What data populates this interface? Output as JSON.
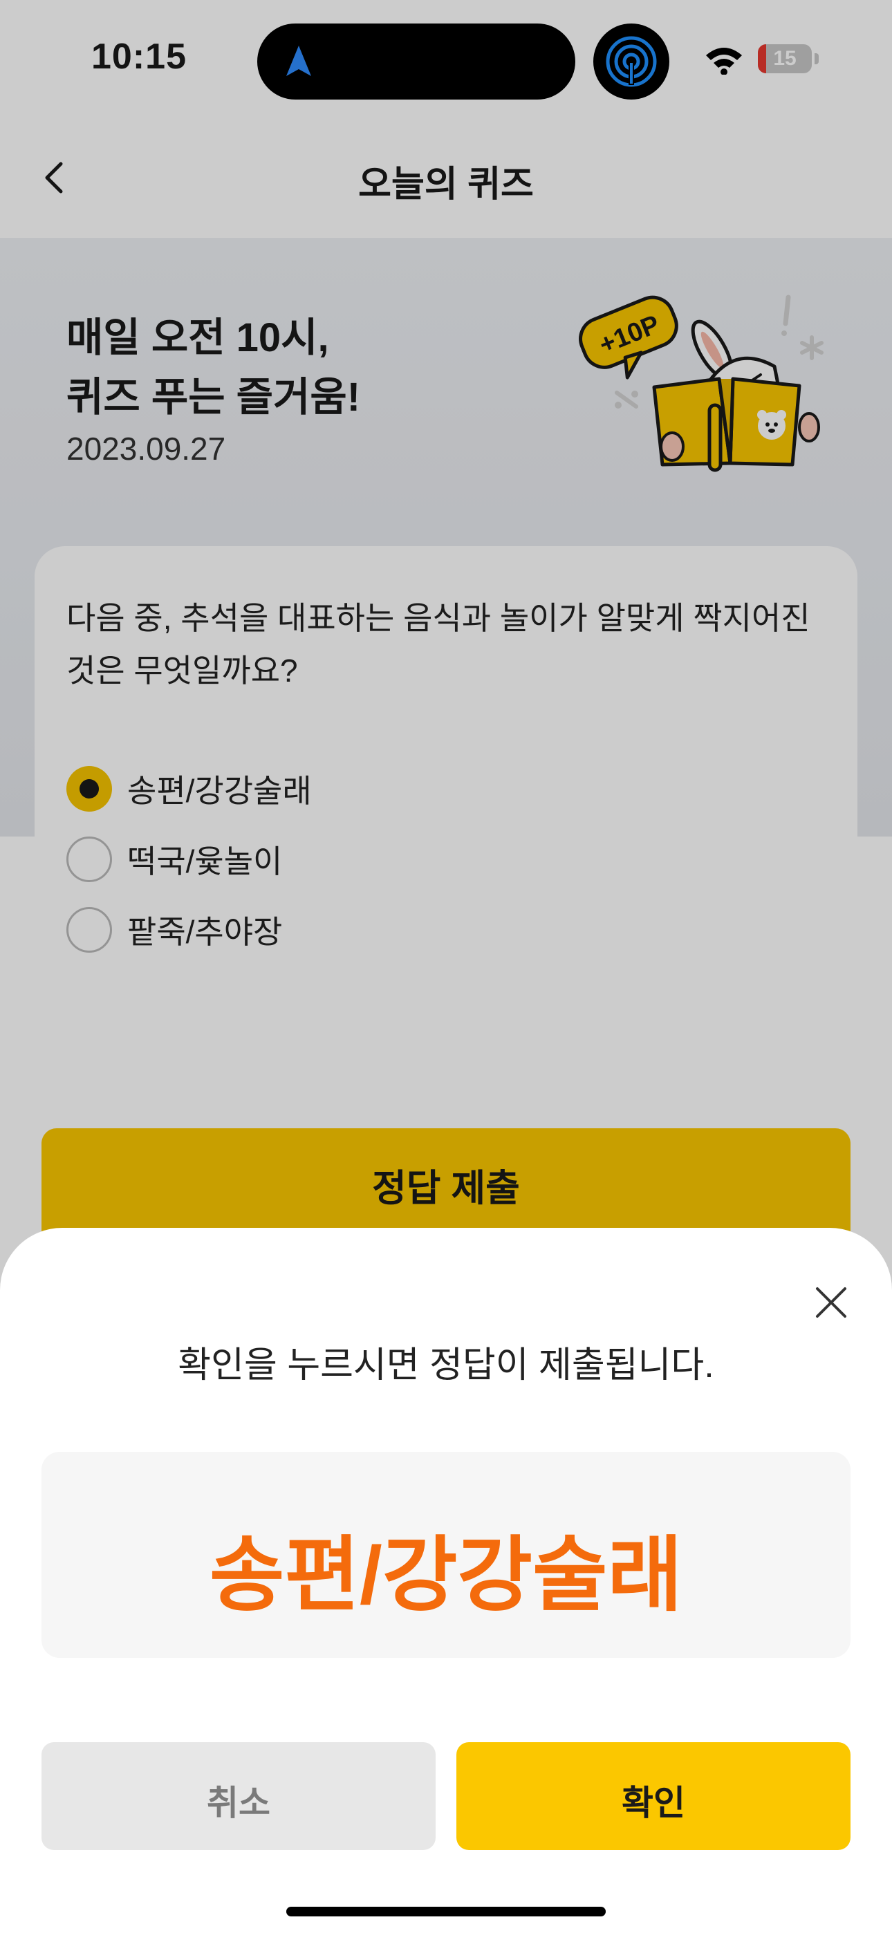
{
  "status_bar": {
    "time": "10:15",
    "battery_level": "15",
    "battery_fraction": 0.15
  },
  "header": {
    "title": "오늘의 퀴즈"
  },
  "hero": {
    "heading": "매일 오전 10시,\n퀴즈 푸는 즐거움!",
    "date": "2023.09.27",
    "badge": "+10P"
  },
  "quiz": {
    "question": "다음 중, 추석을 대표하는 음식과 놀이가 알맞게 짝지어진 것은 무엇일까요?",
    "options": [
      {
        "label": "송편/강강술래",
        "selected": true
      },
      {
        "label": "떡국/윷놀이",
        "selected": false
      },
      {
        "label": "팥죽/추야장",
        "selected": false
      }
    ],
    "submit_label": "정답 제출"
  },
  "sheet": {
    "message": "확인을 누르시면 정답이 제출됩니다.",
    "selected_answer": "송편/강강술래",
    "cancel_label": "취소",
    "confirm_label": "확인"
  },
  "colors": {
    "accent": "#fbc700",
    "answer": "#f46b0c",
    "battery_low": "#e6382f"
  },
  "icons": [
    "navigation-arrow-icon",
    "airdrop-icon",
    "wifi-icon",
    "battery-icon",
    "back-chevron-icon",
    "close-icon"
  ]
}
